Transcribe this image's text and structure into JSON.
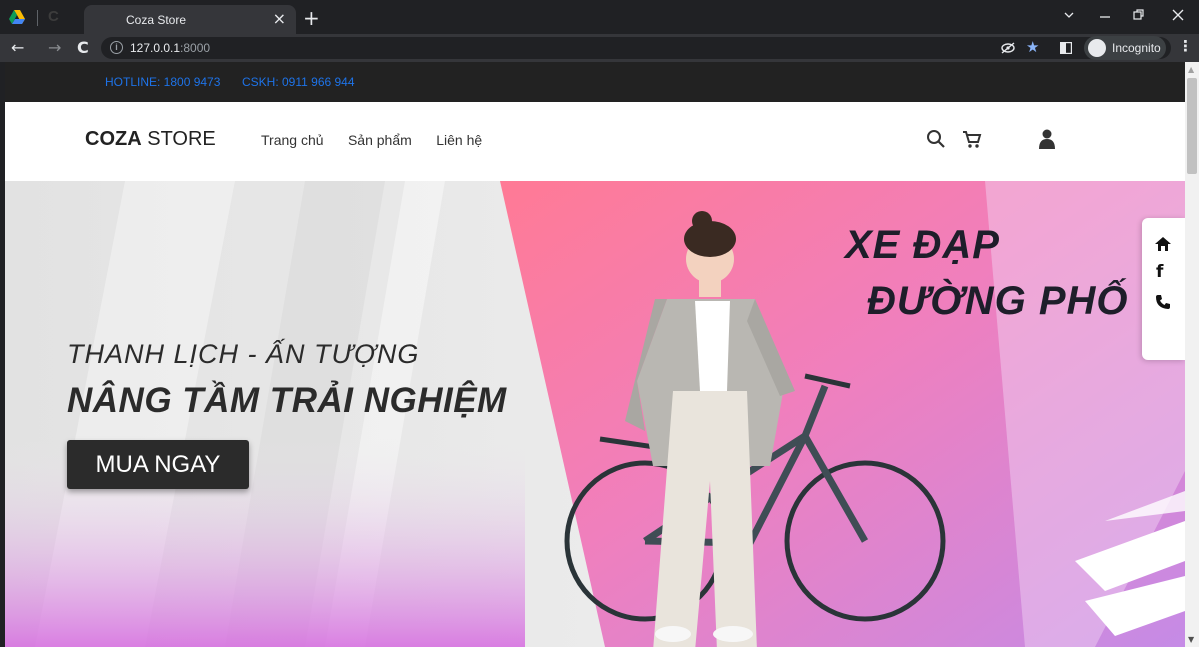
{
  "browser": {
    "tab_title": "Coza Store",
    "tab_close": "×",
    "new_tab": "+",
    "url_host": "127.0.0.1",
    "url_port": ":8000",
    "incognito_label": "Incognito",
    "window_controls": [
      "chevron-down-icon",
      "minimize-icon",
      "restore-icon",
      "close-icon"
    ]
  },
  "topbar": {
    "hotline": "HOTLINE: 1800 9473",
    "cskh": "CSKH: 0911 966 944",
    "link_color": "#1e73e8"
  },
  "header": {
    "logo_bold": "COZA",
    "logo_light": " STORE",
    "menu": [
      "Trang chủ",
      "Sản phẩm",
      "Liên hệ"
    ]
  },
  "hero": {
    "subtitle": "THANH LỊCH - ẤN TƯỢNG",
    "title": "NÂNG TẦM TRẢI NGHIỆM",
    "cta": "MUA NGAY",
    "promo_line1": "XE ĐẠP",
    "promo_line2": "ĐƯỜNG PHỐ",
    "accent_pink": "#f27ab0",
    "accent_violet": "#c58be6"
  },
  "social": [
    "home-icon",
    "facebook-icon",
    "phone-icon"
  ]
}
